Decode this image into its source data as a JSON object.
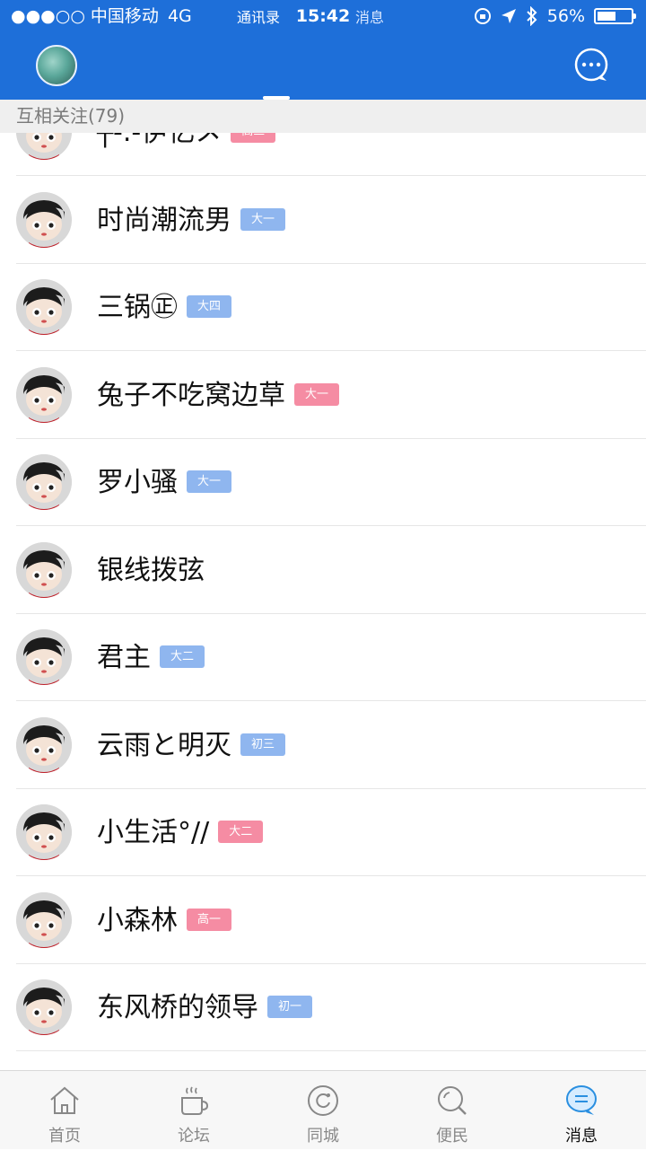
{
  "status_bar": {
    "carrier": "●●●○○ 中国移动",
    "network": "4G",
    "time": "15:42",
    "battery": "56%",
    "battery_level": 0.56
  },
  "header": {
    "tabs": [
      {
        "label": "通讯录",
        "active": true
      },
      {
        "label": "消息",
        "active": false
      }
    ]
  },
  "section": {
    "title": "互相关注(79)"
  },
  "contacts": [
    {
      "name": "┿-.-伊忆メ",
      "tag": "高三",
      "tag_color": "#f58ca3"
    },
    {
      "name": "时尚潮流男",
      "tag": "大一",
      "tag_color": "#8fb6ef"
    },
    {
      "name": "三锅㊣",
      "tag": "大四",
      "tag_color": "#8fb6ef"
    },
    {
      "name": "兔子不吃窝边草",
      "tag": "大一",
      "tag_color": "#f58ca3"
    },
    {
      "name": "罗小骚",
      "tag": "大一",
      "tag_color": "#8fb6ef"
    },
    {
      "name": "银线拨弦",
      "tag": "",
      "tag_color": ""
    },
    {
      "name": "君主",
      "tag": "大二",
      "tag_color": "#8fb6ef"
    },
    {
      "name": "云雨と明灭",
      "tag": "初三",
      "tag_color": "#8fb6ef"
    },
    {
      "name": "小生活°//",
      "tag": "大二",
      "tag_color": "#f58ca3"
    },
    {
      "name": "小森林",
      "tag": "高一",
      "tag_color": "#f58ca3"
    },
    {
      "name": "东风桥的领导",
      "tag": "初一",
      "tag_color": "#8fb6ef"
    }
  ],
  "tabbar": [
    {
      "label": "首页",
      "icon": "home-icon"
    },
    {
      "label": "论坛",
      "icon": "coffee-cup-icon"
    },
    {
      "label": "同城",
      "icon": "refresh-circle-icon"
    },
    {
      "label": "便民",
      "icon": "magnifier-icon"
    },
    {
      "label": "消息",
      "icon": "chat-bubble-icon",
      "active": true
    }
  ],
  "colors": {
    "brand": "#1e6fd9",
    "pink_tag": "#f58ca3",
    "blue_tag": "#8fb6ef"
  }
}
